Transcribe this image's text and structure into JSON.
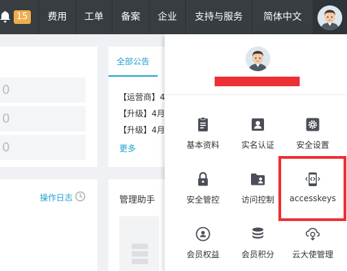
{
  "topbar": {
    "notification_count": "15",
    "nav": [
      "费用",
      "工单",
      "备案",
      "企业",
      "支持与服务",
      "简体中文"
    ]
  },
  "stats": {
    "values": [
      "0",
      "0",
      "0"
    ]
  },
  "announcements": {
    "tab_label": "全部公告",
    "items": [
      "【运营商】4",
      "【升级】4月",
      "【升级】4月"
    ],
    "more_label": "更多"
  },
  "operation_log_label": "操作日志",
  "helper_title": "管理助手",
  "user_menu": {
    "items": [
      {
        "label": "基本资料",
        "icon": "id-card-icon"
      },
      {
        "label": "实名认证",
        "icon": "person-badge-icon"
      },
      {
        "label": "安全设置",
        "icon": "gear-icon"
      },
      {
        "label": "安全管控",
        "icon": "lock-icon"
      },
      {
        "label": "访问控制",
        "icon": "folder-user-icon"
      },
      {
        "label": "accesskeys",
        "icon": "phone-code-icon"
      },
      {
        "label": "会员权益",
        "icon": "member-circle-icon"
      },
      {
        "label": "会员积分",
        "icon": "coins-stack-icon"
      },
      {
        "label": "云大使管理",
        "icon": "cloud-ambassador-icon"
      }
    ]
  },
  "colors": {
    "topbar_bg": "#373d41",
    "accent": "#1fa1cf",
    "badge": "#f0ad4e",
    "highlight": "#ee2f35",
    "icon": "#4a4f57"
  }
}
